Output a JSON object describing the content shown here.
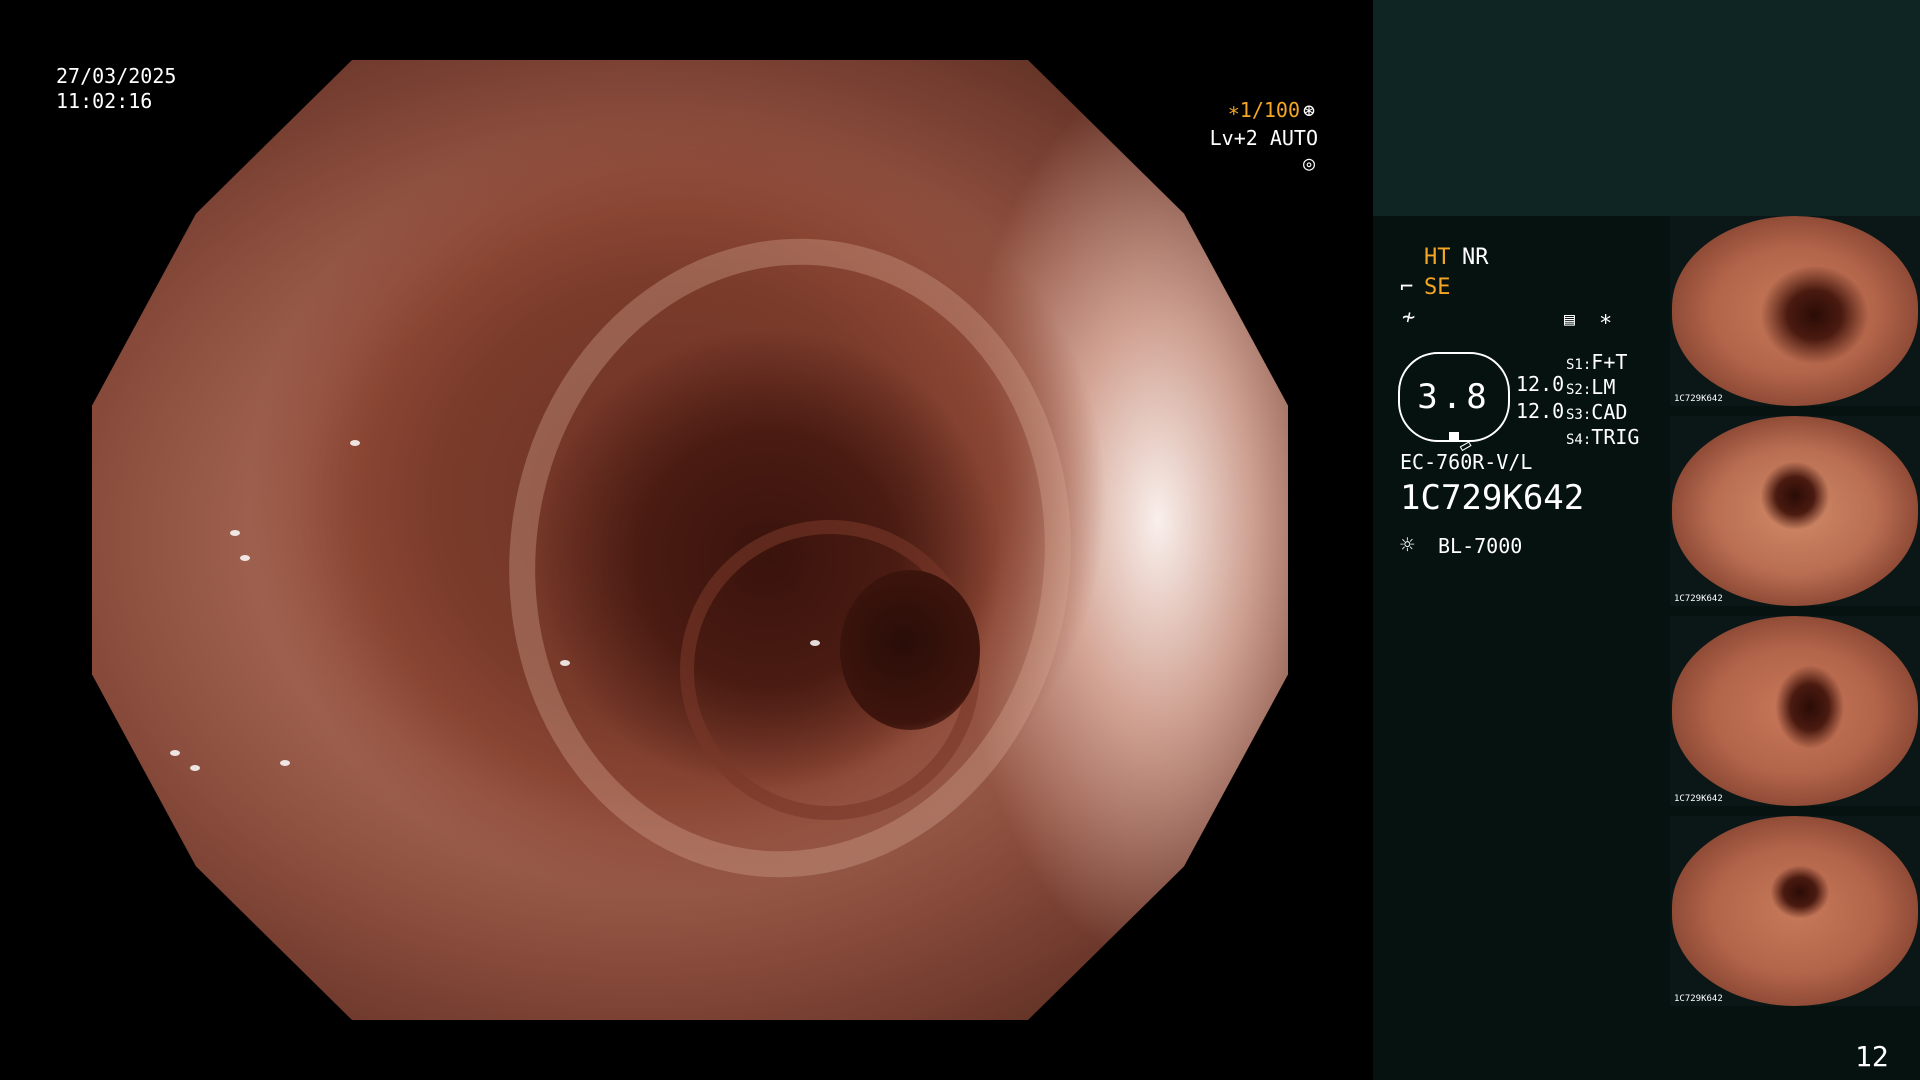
{
  "main": {
    "date": "27/03/2025",
    "time": "11:02:16",
    "shutter": "∗1/100",
    "level": "Lv+2 AUTO"
  },
  "panel": {
    "ht": "HT",
    "nr": "NR",
    "se": "SE",
    "asterisk": "∗",
    "zoom_value": "3.8",
    "val1": "12.0",
    "val2": "12.0",
    "s1_label": "S1:",
    "s1_value": "F+T",
    "s2_label": "S2:",
    "s2_value": "LM",
    "s3_label": "S3:",
    "s3_value": "CAD",
    "s4_label": "S4:",
    "s4_value": "TRIG",
    "scope_model": "EC-760R-V/L",
    "serial": "1C729K642",
    "light_source": "BL-7000"
  },
  "thumbnails": [
    {
      "label": "1C729K642"
    },
    {
      "label": "1C729K642"
    },
    {
      "label": "1C729K642"
    },
    {
      "label": "1C729K642"
    }
  ],
  "page_number": "12",
  "colors": {
    "accent_amber": "#f5a623",
    "panel_background": "#061210",
    "panel_top_background": "#0e2524"
  }
}
